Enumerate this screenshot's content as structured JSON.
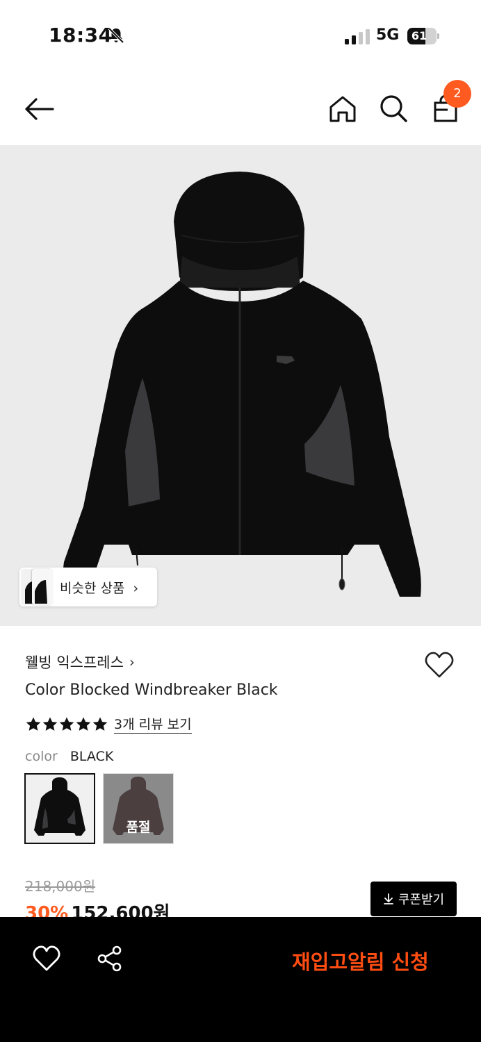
{
  "status_bar": {
    "time": "18:34",
    "network": "5G",
    "battery_level": "61",
    "battery_fraction": 0.61
  },
  "header": {
    "cart_count": "2"
  },
  "gallery": {
    "similar_label": "비슷한 상품",
    "similar_chevron": "›"
  },
  "product": {
    "brand": "웰빙 익스프레스",
    "brand_chevron": "›",
    "name": "Color Blocked Windbreaker Black",
    "rating_stars": 5,
    "review_link": "3개 리뷰 보기",
    "color_label": "color",
    "color_value": "BLACK",
    "swatches": [
      {
        "name": "BLACK",
        "selected": true
      },
      {
        "name": "",
        "sold_out_label": "품절"
      }
    ]
  },
  "price": {
    "original": "218,000원",
    "discount": "30%",
    "sale": "152,600원",
    "coupon_label": "쿠폰받기"
  },
  "bottom_bar": {
    "cta": "재입고알림 신청"
  },
  "colors": {
    "accent": "#ff5a1f",
    "cta": "#ff4d12",
    "image_bg": "#ebebeb"
  }
}
